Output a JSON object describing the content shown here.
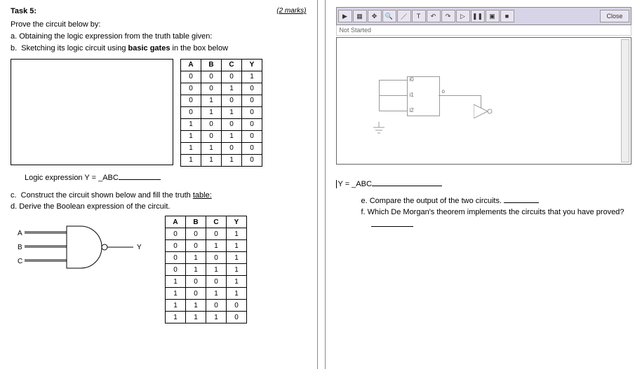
{
  "header": {
    "task": "Task 5:",
    "marks": "(2 marks)"
  },
  "intro": "Prove the circuit below by:",
  "steps_ab": {
    "a": "a.  Obtaining the logic expression from the truth table given:",
    "b": "b.  Sketching its logic circuit using basic gates in the box below"
  },
  "truth1": {
    "head": [
      "A",
      "B",
      "C",
      "Y"
    ],
    "rows": [
      [
        "0",
        "0",
        "0",
        "1"
      ],
      [
        "0",
        "0",
        "1",
        "0"
      ],
      [
        "0",
        "1",
        "0",
        "0"
      ],
      [
        "0",
        "1",
        "1",
        "0"
      ],
      [
        "1",
        "0",
        "0",
        "0"
      ],
      [
        "1",
        "0",
        "1",
        "0"
      ],
      [
        "1",
        "1",
        "0",
        "0"
      ],
      [
        "1",
        "1",
        "1",
        "0"
      ]
    ]
  },
  "expr1_label": "Logic expression Y = _ABC",
  "steps_cd": {
    "c": "c.  Construct the circuit shown below and fill the truth table:",
    "d": "d.  Derive the Boolean expression of the circuit."
  },
  "nand_inputs": {
    "a": "A",
    "b": "B",
    "c": "C",
    "y": "Y"
  },
  "truth2": {
    "head": [
      "A",
      "B",
      "C",
      "Y"
    ],
    "rows": [
      [
        "0",
        "0",
        "0",
        "1"
      ],
      [
        "0",
        "0",
        "1",
        "1"
      ],
      [
        "0",
        "1",
        "0",
        "1"
      ],
      [
        "0",
        "1",
        "1",
        "1"
      ],
      [
        "1",
        "0",
        "0",
        "1"
      ],
      [
        "1",
        "0",
        "1",
        "1"
      ],
      [
        "1",
        "1",
        "0",
        "0"
      ],
      [
        "1",
        "1",
        "1",
        "0"
      ]
    ]
  },
  "sim": {
    "title": "Not Started",
    "close": "Close",
    "pins": {
      "in0": "i0",
      "in1": "i1",
      "in2": "i2",
      "out": "o"
    }
  },
  "expr2_label": "Y = _ABC",
  "steps_ef": {
    "e": "e.  Compare the output of the two circuits.",
    "f": "f.  Which De Morgan's theorem implements the circuits that you have proved?"
  }
}
